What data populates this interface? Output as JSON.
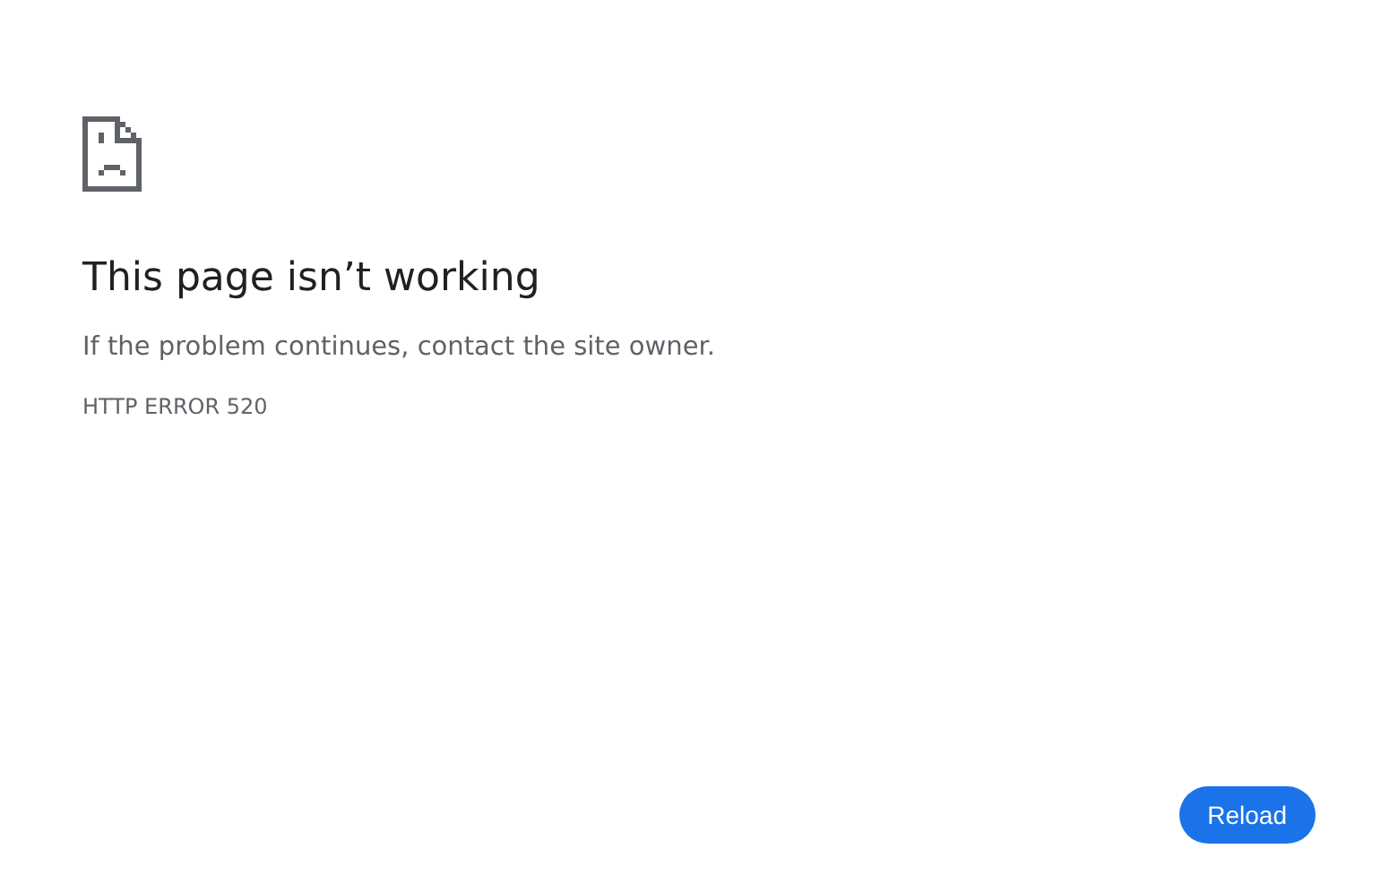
{
  "heading": "This page isn’t working",
  "message": "If the problem continues, contact the site owner.",
  "error_code": "HTTP ERROR 520",
  "buttons": [
    {
      "label": "Reload"
    }
  ]
}
